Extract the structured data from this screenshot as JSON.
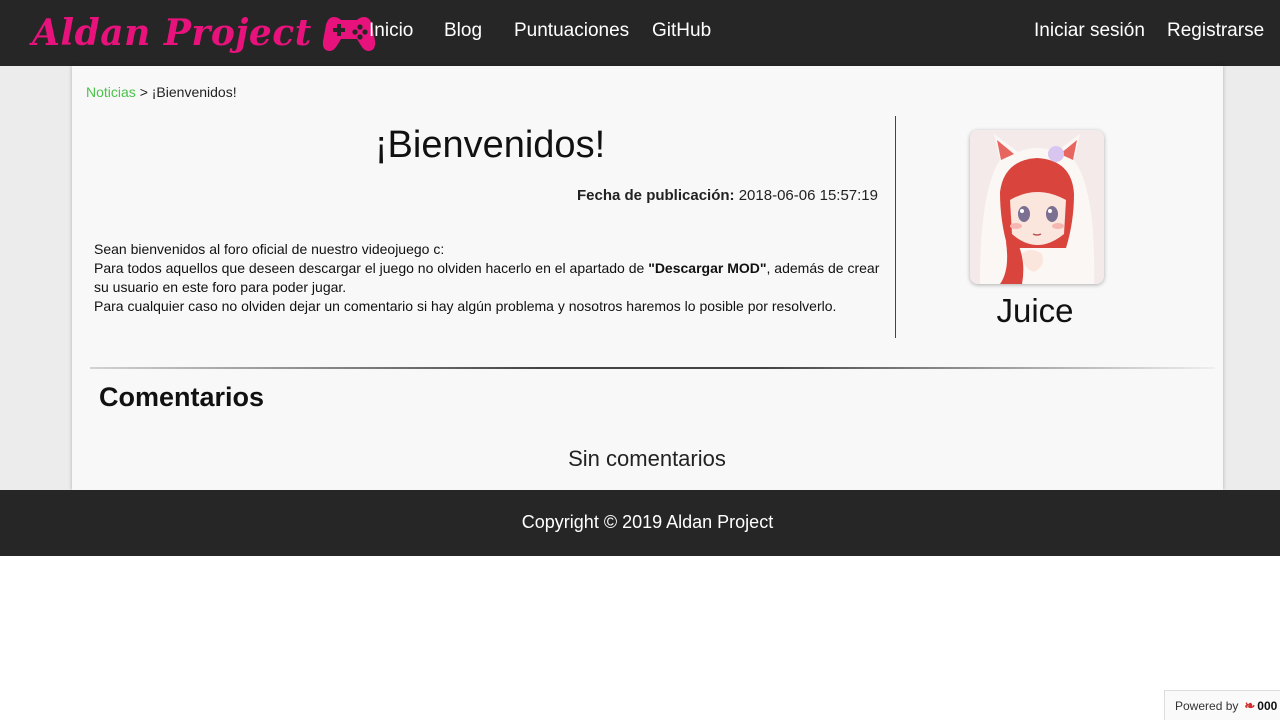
{
  "header": {
    "logo_text": "Aldan Project",
    "nav": [
      {
        "label": "Inicio"
      },
      {
        "label": "Blog"
      },
      {
        "label": "Puntuaciones"
      },
      {
        "label": "GitHub"
      }
    ],
    "auth": {
      "login": "Iniciar sesión",
      "register": "Registrarse"
    }
  },
  "breadcrumb": {
    "parent": "Noticias",
    "separator": ">",
    "current": "¡Bienvenidos!"
  },
  "post": {
    "title": "¡Bienvenidos!",
    "date_label": "Fecha de publicación:",
    "date_value": "2018-06-06 15:57:19",
    "body": {
      "line1": "Sean bienvenidos al foro oficial de nuestro videojuego c:",
      "line2_pre": "Para todos aquellos que deseen descargar el juego no olviden hacerlo en el apartado de ",
      "line2_bold": "\"Descargar MOD\"",
      "line2_post": ", además de crear su usuario en este foro para poder jugar.",
      "line3": "Para cualquier caso no olviden dejar un comentario si hay algún problema y nosotros haremos lo posible por resolverlo."
    }
  },
  "author": {
    "name": "Juice"
  },
  "comments": {
    "title": "Comentarios",
    "empty_text": "Sin comentarios"
  },
  "footer": {
    "copyright": "Copyright © 2019 Aldan Project"
  },
  "powered": {
    "label": "Powered by",
    "badge": "000"
  },
  "colors": {
    "brand": "#e8127c",
    "link": "#4cc24a",
    "bar": "#262626"
  }
}
